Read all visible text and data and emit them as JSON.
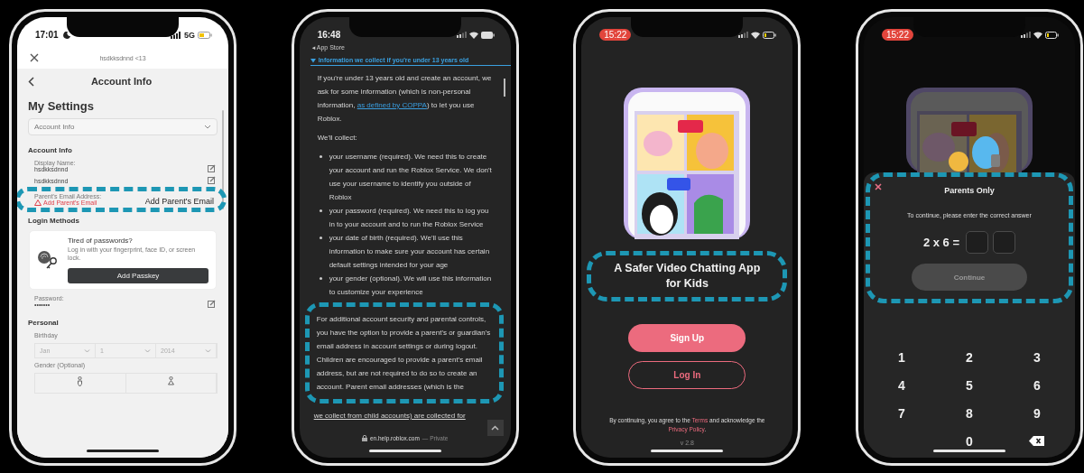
{
  "account_screen": {
    "status_bar": {
      "time": "17:01",
      "network": "5G"
    },
    "account_label": "hsdkksdnnd <13",
    "title": "Account Info",
    "heading": "My Settings",
    "section_select": "Account Info",
    "account_info": {
      "heading": "Account Info",
      "display_name_label": "Display Name:",
      "display_name": "hsdkksdnnd",
      "username": "hsdkksdnnd",
      "parent_email_label": "Parent's Email Address:",
      "parent_email_warning": "Add Parent's Email"
    },
    "annotation": "Add Parent's Email",
    "login_methods": {
      "heading": "Login Methods",
      "passkey_title": "Tired of passwords?",
      "passkey_text": "Log in with your fingerprint, face ID, or screen lock.",
      "passkey_button": "Add Passkey",
      "password_label": "Password:",
      "password_value": "•••••••"
    },
    "personal": {
      "heading": "Personal",
      "birthday_label": "Birthday",
      "birthday": [
        "Jan",
        "1",
        "2014"
      ],
      "gender_label": "Gender (Optional)"
    }
  },
  "help_screen": {
    "status_bar": {
      "time": "16:48",
      "back_app": "◂ App Store"
    },
    "section_title": "Information we collect if you're under 13 years old",
    "expanded": true,
    "intro": {
      "before": "If you're under 13 years old and create an account, we ask for some information (which is non-personal information, ",
      "link": "as defined by COPPA",
      "after": ") to let you use Roblox."
    },
    "collect_heading": "We'll collect:",
    "items": [
      "your username (required). We need this to create your account and run the Roblox Service. We don't use your username to identify you outside of Roblox",
      "your password (required). We need this to log you in to your account and to run the Roblox Service",
      "your date of birth (required). We'll use this information to make sure your account has certain default settings intended for your age",
      "your gender (optional). We will use this information to customize your experience"
    ],
    "parent_paragraph": "For additional account security and parental controls, you have the option to provide a parent's or guardian's email address in account settings or during logout. Children are encouraged to provide a parent's email address, but are not required to do so to create an account. Parent email addresses (which is the",
    "last_line": "we collect from child accounts) are collected for",
    "url": "en.help.roblox.com",
    "url_note": "— Private"
  },
  "welcome_screen": {
    "status_bar": {
      "time": "15:22"
    },
    "title": "A Safer Video Chatting App for Kids",
    "sign_up": "Sign Up",
    "log_in": "Log In",
    "legal": {
      "before": "By continuing, you agree to the ",
      "terms": "Terms",
      "middle": " and acknowledge the ",
      "privacy": "Privacy Policy",
      "after": "."
    },
    "version": "v 2.8"
  },
  "parent_gate_screen": {
    "status_bar": {
      "time": "15:22"
    },
    "title": "Parents Only",
    "instruction": "To continue, please enter the correct answer",
    "question": "2 x 6 =",
    "answer_boxes": [
      {
        "filled": false
      },
      {
        "filled": false
      }
    ],
    "continue_button": {
      "label": "Continue",
      "disabled": true
    },
    "keys": [
      {
        "kind": "digit",
        "label": "1"
      },
      {
        "kind": "digit",
        "label": "2"
      },
      {
        "kind": "digit",
        "label": "3"
      },
      {
        "kind": "digit",
        "label": "4"
      },
      {
        "kind": "digit",
        "label": "5"
      },
      {
        "kind": "digit",
        "label": "6"
      },
      {
        "kind": "digit",
        "label": "7"
      },
      {
        "kind": "digit",
        "label": "8"
      },
      {
        "kind": "digit",
        "label": "9"
      },
      {
        "kind": "blank"
      },
      {
        "kind": "digit",
        "label": "0"
      },
      {
        "kind": "backspace"
      }
    ]
  }
}
